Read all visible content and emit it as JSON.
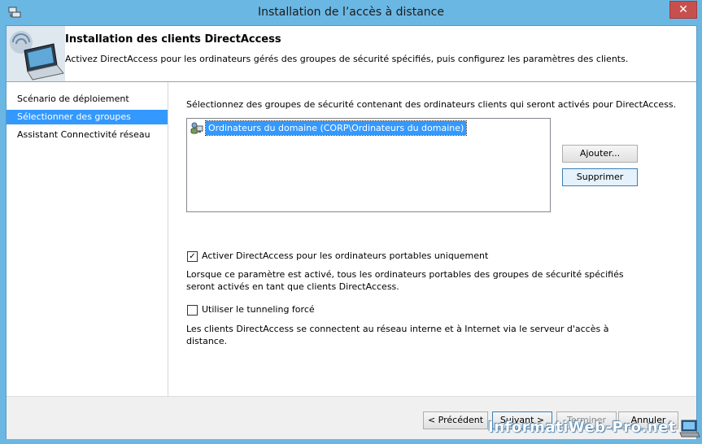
{
  "window": {
    "title": "Installation de l’accès à distance",
    "close_label": "✕"
  },
  "header": {
    "title": "Installation des clients DirectAccess",
    "subtitle": "Activez DirectAccess pour les ordinateurs gérés des groupes de sécurité spécifiés, puis configurez les paramètres des clients."
  },
  "nav": {
    "items": [
      {
        "label": "Scénario de déploiement",
        "selected": false
      },
      {
        "label": "Sélectionner des groupes",
        "selected": true
      },
      {
        "label": "Assistant Connectivité réseau",
        "selected": false
      }
    ]
  },
  "main": {
    "instruction": "Sélectionnez des groupes de sécurité contenant des ordinateurs clients qui seront activés pour DirectAccess.",
    "groups": [
      "Ordinateurs du domaine (CORP\\Ordinateurs du domaine)"
    ],
    "add_button": "Ajouter...",
    "remove_button": "Supprimer",
    "laptops_checkbox": {
      "label": "Activer DirectAccess pour les ordinateurs portables uniquement",
      "checked": true
    },
    "laptops_desc": "Lorsque ce paramètre est activé, tous les ordinateurs portables des groupes de sécurité spécifiés seront activés en tant que clients DirectAccess.",
    "tunnel_checkbox": {
      "label": "Utiliser le tunneling forcé",
      "checked": false
    },
    "tunnel_desc": "Les clients DirectAccess se connectent au réseau interne et à Internet via le serveur d'accès à distance."
  },
  "footer": {
    "prev": "< Précédent",
    "next": "Suivant >",
    "finish": "Terminer",
    "cancel": "Annuler"
  },
  "watermark": "InformatiWeb-Pro.net",
  "icons": {
    "app": "remote-access-icon",
    "group": "group-icon",
    "check": "✓"
  }
}
